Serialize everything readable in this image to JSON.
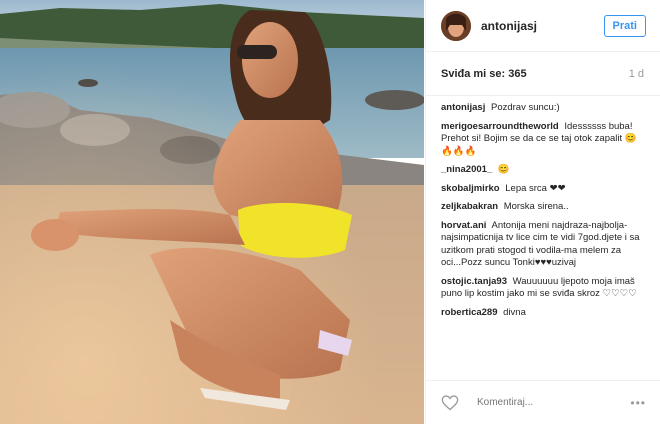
{
  "header": {
    "username": "antonijasj",
    "follow_label": "Prati"
  },
  "meta": {
    "likes": "Sviđa mi se: 365",
    "time": "1 d"
  },
  "comments": [
    {
      "user": "antonijasj",
      "text": "Pozdrav suncu:)"
    },
    {
      "user": "merigoesarroundtheworld",
      "text": "Idessssss buba! Prehot si! Bojim se da ce se taj otok zapalit 😊🔥🔥🔥"
    },
    {
      "user": "_nina2001_",
      "text": "😊"
    },
    {
      "user": "skobaljmirko",
      "text": "Lepa srca ❤❤"
    },
    {
      "user": "zeljkabakran",
      "text": "Morska sirena.."
    },
    {
      "user": "horvat.ani",
      "text": "Antonija meni najdraza-najbolja-najsimpaticnija tv lice cim te vidi 7god.djete i sa uzitkom prati stogod ti vodila-ma melem za oci...Pozz suncu Tonki♥♥♥uzivaj"
    },
    {
      "user": "ostojic.tanja93",
      "text": "Wauuuuuu ljepoto moja imaš puno lip kostim jako mi se sviđa skroz ♡♡♡♡"
    },
    {
      "user": "robertica289",
      "text": "divna"
    }
  ],
  "footer": {
    "comment_placeholder": "Komentiraj...",
    "more_label": "•••"
  },
  "icons": {
    "like": "heart-outline-icon",
    "more": "ellipsis-icon"
  },
  "colors": {
    "accent": "#3897f0",
    "text": "#262626",
    "muted": "#999999"
  }
}
